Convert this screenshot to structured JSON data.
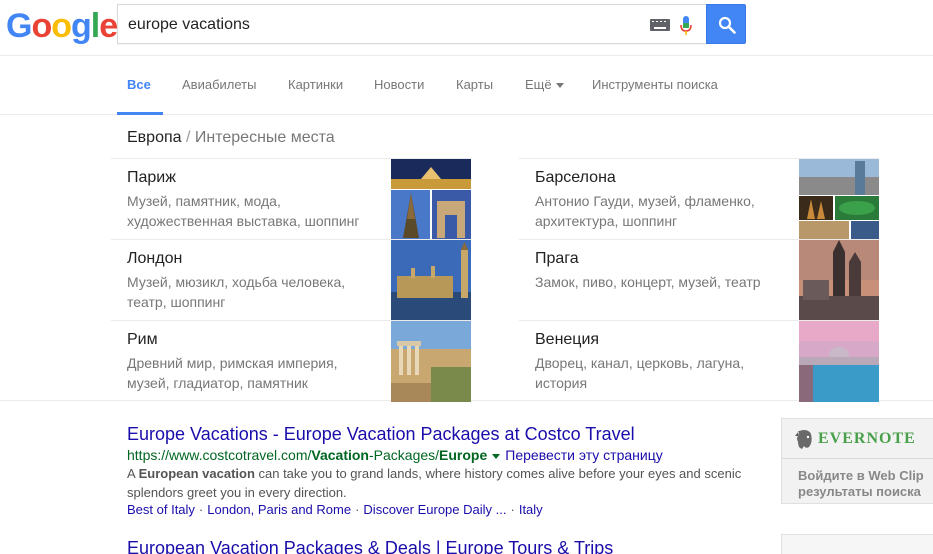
{
  "logo": {
    "letters": [
      "G",
      "o",
      "o",
      "g",
      "l",
      "e"
    ]
  },
  "search": {
    "query": "europe vacations"
  },
  "tabs": [
    {
      "label": "Все"
    },
    {
      "label": "Авиабилеты"
    },
    {
      "label": "Картинки"
    },
    {
      "label": "Новости"
    },
    {
      "label": "Карты"
    },
    {
      "label": "Ещё"
    },
    {
      "label": "Инструменты поиска"
    }
  ],
  "carousel": {
    "title": "Европа",
    "separator": "/",
    "subtitle": "Интересные места",
    "places": [
      {
        "name": "Париж",
        "desc": "Музей, памятник, мода, художественная выставка, шоппинг"
      },
      {
        "name": "Барселона",
        "desc": "Антонио Гауди, музей, фламенко, архитектура, шоппинг"
      },
      {
        "name": "Лондон",
        "desc": "Музей, мюзикл, ходьба человека, театр, шоппинг"
      },
      {
        "name": "Прага",
        "desc": "Замок, пиво, концерт, музей, театр"
      },
      {
        "name": "Рим",
        "desc": "Древний мир, римская империя, музей, гладиатор, памятник"
      },
      {
        "name": "Венеция",
        "desc": "Дворец, канал, церковь, лагуна, история"
      }
    ]
  },
  "results": [
    {
      "title": "Europe Vacations - Europe Vacation Packages at Costco Travel",
      "url_prefix": "https://www.costcotravel.com/",
      "url_bold1": "Vacation",
      "url_mid": "-Packages/",
      "url_bold2": "Europe",
      "translate": "Перевести эту страницу",
      "snippet_a": "A ",
      "snippet_b": "European vacation",
      "snippet_c": " can take you to grand lands, where history comes alive before your eyes and scenic splendors greet you in every direction.",
      "links": [
        "Best of Italy",
        "London, Paris and Rome",
        "Discover Europe Daily ...",
        "Italy"
      ]
    },
    {
      "title": "European Vacation Packages & Deals | Europe Tours & Trips"
    }
  ],
  "evernote": {
    "name": "EVERNOTE",
    "line1": "Войдите в Web Clip",
    "line2": "результаты поиска"
  },
  "colors": {
    "accent": "#4285f4",
    "link": "#1a0dab",
    "url": "#006621",
    "snippet": "#545454",
    "evernote_green": "#4aa04a"
  }
}
